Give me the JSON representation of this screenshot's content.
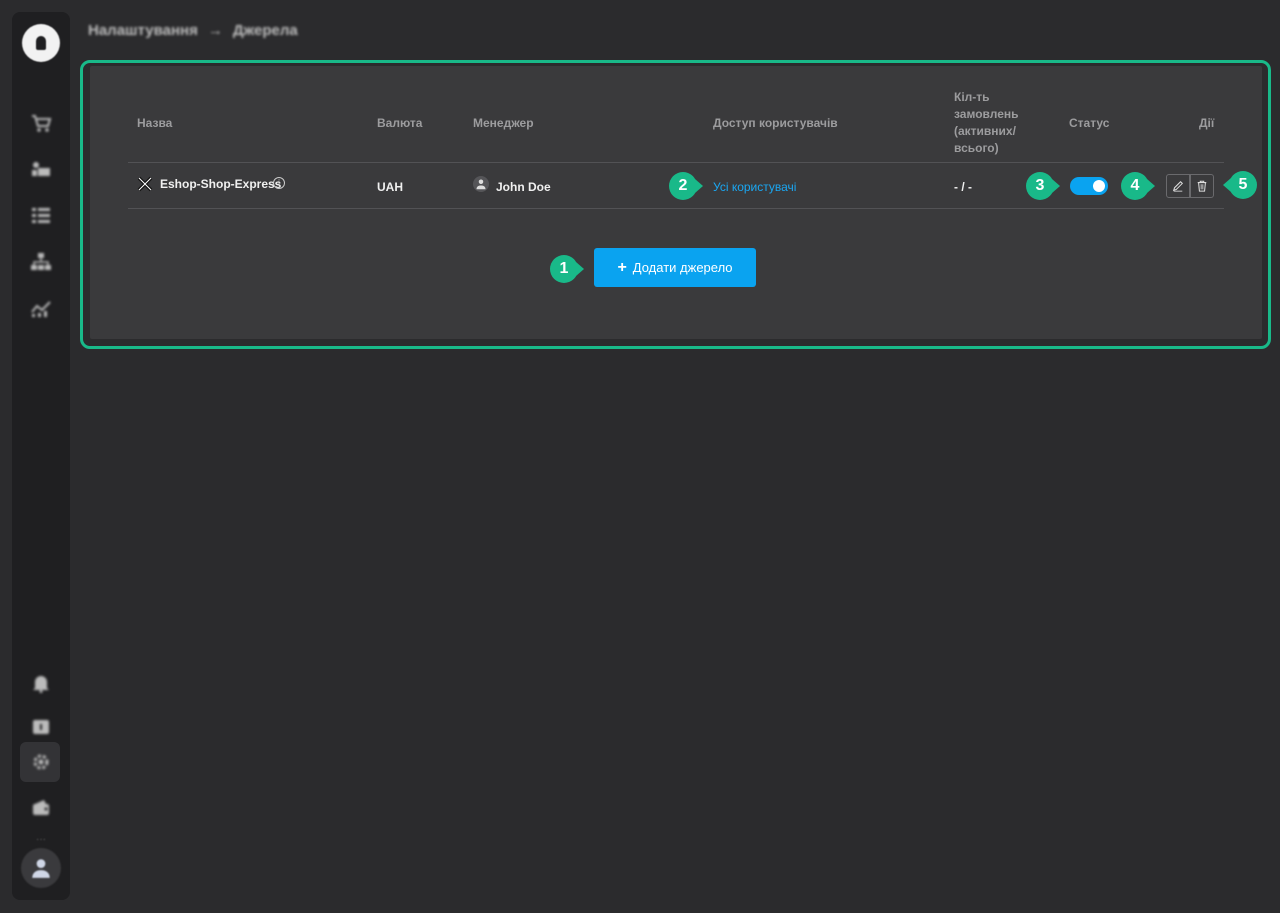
{
  "breadcrumb": {
    "parent": "Налаштування",
    "separator": "→",
    "current": "Джерела"
  },
  "table": {
    "headers": {
      "name": "Назва",
      "currency": "Валюта",
      "manager": "Менеджер",
      "access": "Доступ користувачів",
      "orders_line1": "Кіл-ть",
      "orders_line2": "замовлень",
      "orders_line3": "(активних/",
      "orders_line4": "всього)",
      "status": "Статус",
      "actions": "Дії"
    },
    "rows": [
      {
        "name": "Eshop-Shop-Express",
        "currency": "UAH",
        "manager": "John Doe",
        "access": "Усі користувачі",
        "orders": "- / -",
        "status_on": true
      }
    ]
  },
  "add_button": {
    "label": "Додати джерело"
  },
  "callouts": [
    "1",
    "2",
    "3",
    "4",
    "5"
  ],
  "colors": {
    "accent": "#0aa3f0",
    "callout": "#19b989",
    "panel": "#3a3a3c",
    "background": "#2b2b2d"
  },
  "sidebar_icons": [
    "cart-icon",
    "delivery-icon",
    "list-icon",
    "hierarchy-icon",
    "analytics-icon",
    "bell-icon",
    "help-icon",
    "settings-icon",
    "wallet-icon",
    "user-avatar-icon"
  ]
}
